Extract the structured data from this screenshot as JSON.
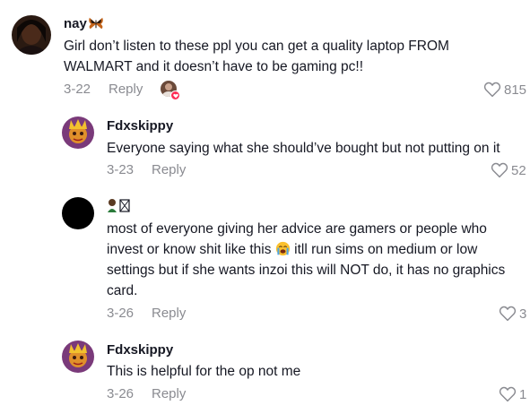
{
  "comments": [
    {
      "username": "nay",
      "username_emoji": "butterfly-icon",
      "text_lines": [
        "Girl don’t listen to these ppl you can get a quality laptop FROM",
        "WALMART and it doesn’t have to be gaming pc!!"
      ],
      "date": "3-22",
      "reply_label": "Reply",
      "likes": "815",
      "creator_liked": true
    },
    {
      "username": "Fdxskippy",
      "text_lines": [
        "Everyone saying what she should’ve bought but not putting on it"
      ],
      "date": "3-23",
      "reply_label": "Reply",
      "likes": "52"
    },
    {
      "username": "🧑🏿‍🦱",
      "text_lines": [
        "most of everyone giving her advice are gamers or people who",
        "invest or know shit like this",
        "itll run sims on medium or low",
        "settings but if she wants inzoi this will NOT do, it has no graphics",
        "card."
      ],
      "inline_emoji": "crying-face-icon",
      "date": "3-26",
      "reply_label": "Reply",
      "likes": "3"
    },
    {
      "username": "Fdxskippy",
      "text_lines": [
        "This is helpful for the op not me"
      ],
      "date": "3-26",
      "reply_label": "Reply",
      "likes": "1"
    }
  ],
  "colors": {
    "text": "#161823",
    "secondary": "#8a8b91",
    "like_badge": "#fe2c55"
  }
}
